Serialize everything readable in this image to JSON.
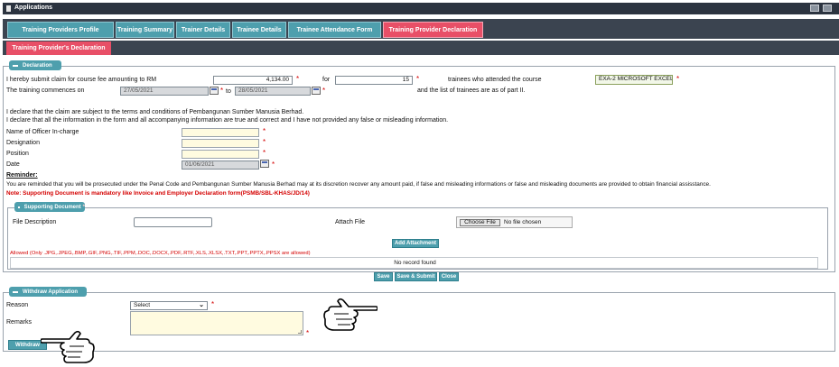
{
  "window": {
    "title": "Applications"
  },
  "tabs": [
    "Training Providers Profile",
    "Training Summary",
    "Trainer Details",
    "Trainee Details",
    "Trainee Attendance Form",
    "Training Provider Declaration"
  ],
  "subtab": "Training Provider's Declaration",
  "declaration": {
    "legend": "Declaration",
    "claim_text": "I hereby submit claim for course fee amounting to RM",
    "amount": "4,134.00",
    "for_label": "for",
    "trainees_count": "15",
    "trainees_text": "trainees who attended the course",
    "course": "EXA-2 MICROSOFT EXCEL",
    "commence_label": "The training commences on",
    "start_date": "27/05/2021",
    "to_label": "to",
    "end_date": "28/05/2021",
    "list_text": "and the list of trainees are as of part II.",
    "declare1": "I declare that the claim are subject to the terms and conditions of Pembangunan Sumber Manusia Berhad.",
    "declare2": "I declare that all the information in the form and all accompanying information are true and correct and I have not provided any false or misleading information.",
    "officer_label": "Name of Officer In-charge",
    "designation_label": "Designation",
    "position_label": "Position",
    "date_label": "Date",
    "date_value": "01/06/2021",
    "reminder_label": "Reminder:",
    "reminder_text": "You are reminded that you will be prosecuted under the Penal Code and Pembangunan Sumber Manusia Berhad may at its discretion recover any amount paid, if false and misleading informations or false and misleading documents are provided to obtain financial assisstance.",
    "note_text": "Note: Supporting Document is mandatory like Invoice and Employer Declaration form(PSMB/SBL-KHAS/JD/14)"
  },
  "supporting": {
    "legend": "Supporting Document",
    "file_desc_label": "File Description",
    "attach_label": "Attach File",
    "choose_file": "Choose File",
    "no_file": "No file chosen",
    "add_button": "Add Attachment",
    "allowed_text": "Allowed (Only .JPG,.JPEG,.BMP,.GIF,.PNG,.TIF,.PPM,.DOC,.DOCX,.PDF,.RTF,.XLS,.XLSX,.TXT,.PPT,.PPTX,.PPSX are allowed)",
    "no_record": "No record found"
  },
  "actions": {
    "save": "Save",
    "save_submit": "Save & Submit",
    "close": "Close"
  },
  "withdraw": {
    "legend": "Withdraw Application",
    "reason_label": "Reason",
    "reason_value": "Select",
    "remarks_label": "Remarks",
    "button": "Withdraw"
  },
  "colors": {
    "teal": "#4e9fad",
    "pink": "#e84f67",
    "dark": "#3b4450",
    "required": "#d40000"
  }
}
